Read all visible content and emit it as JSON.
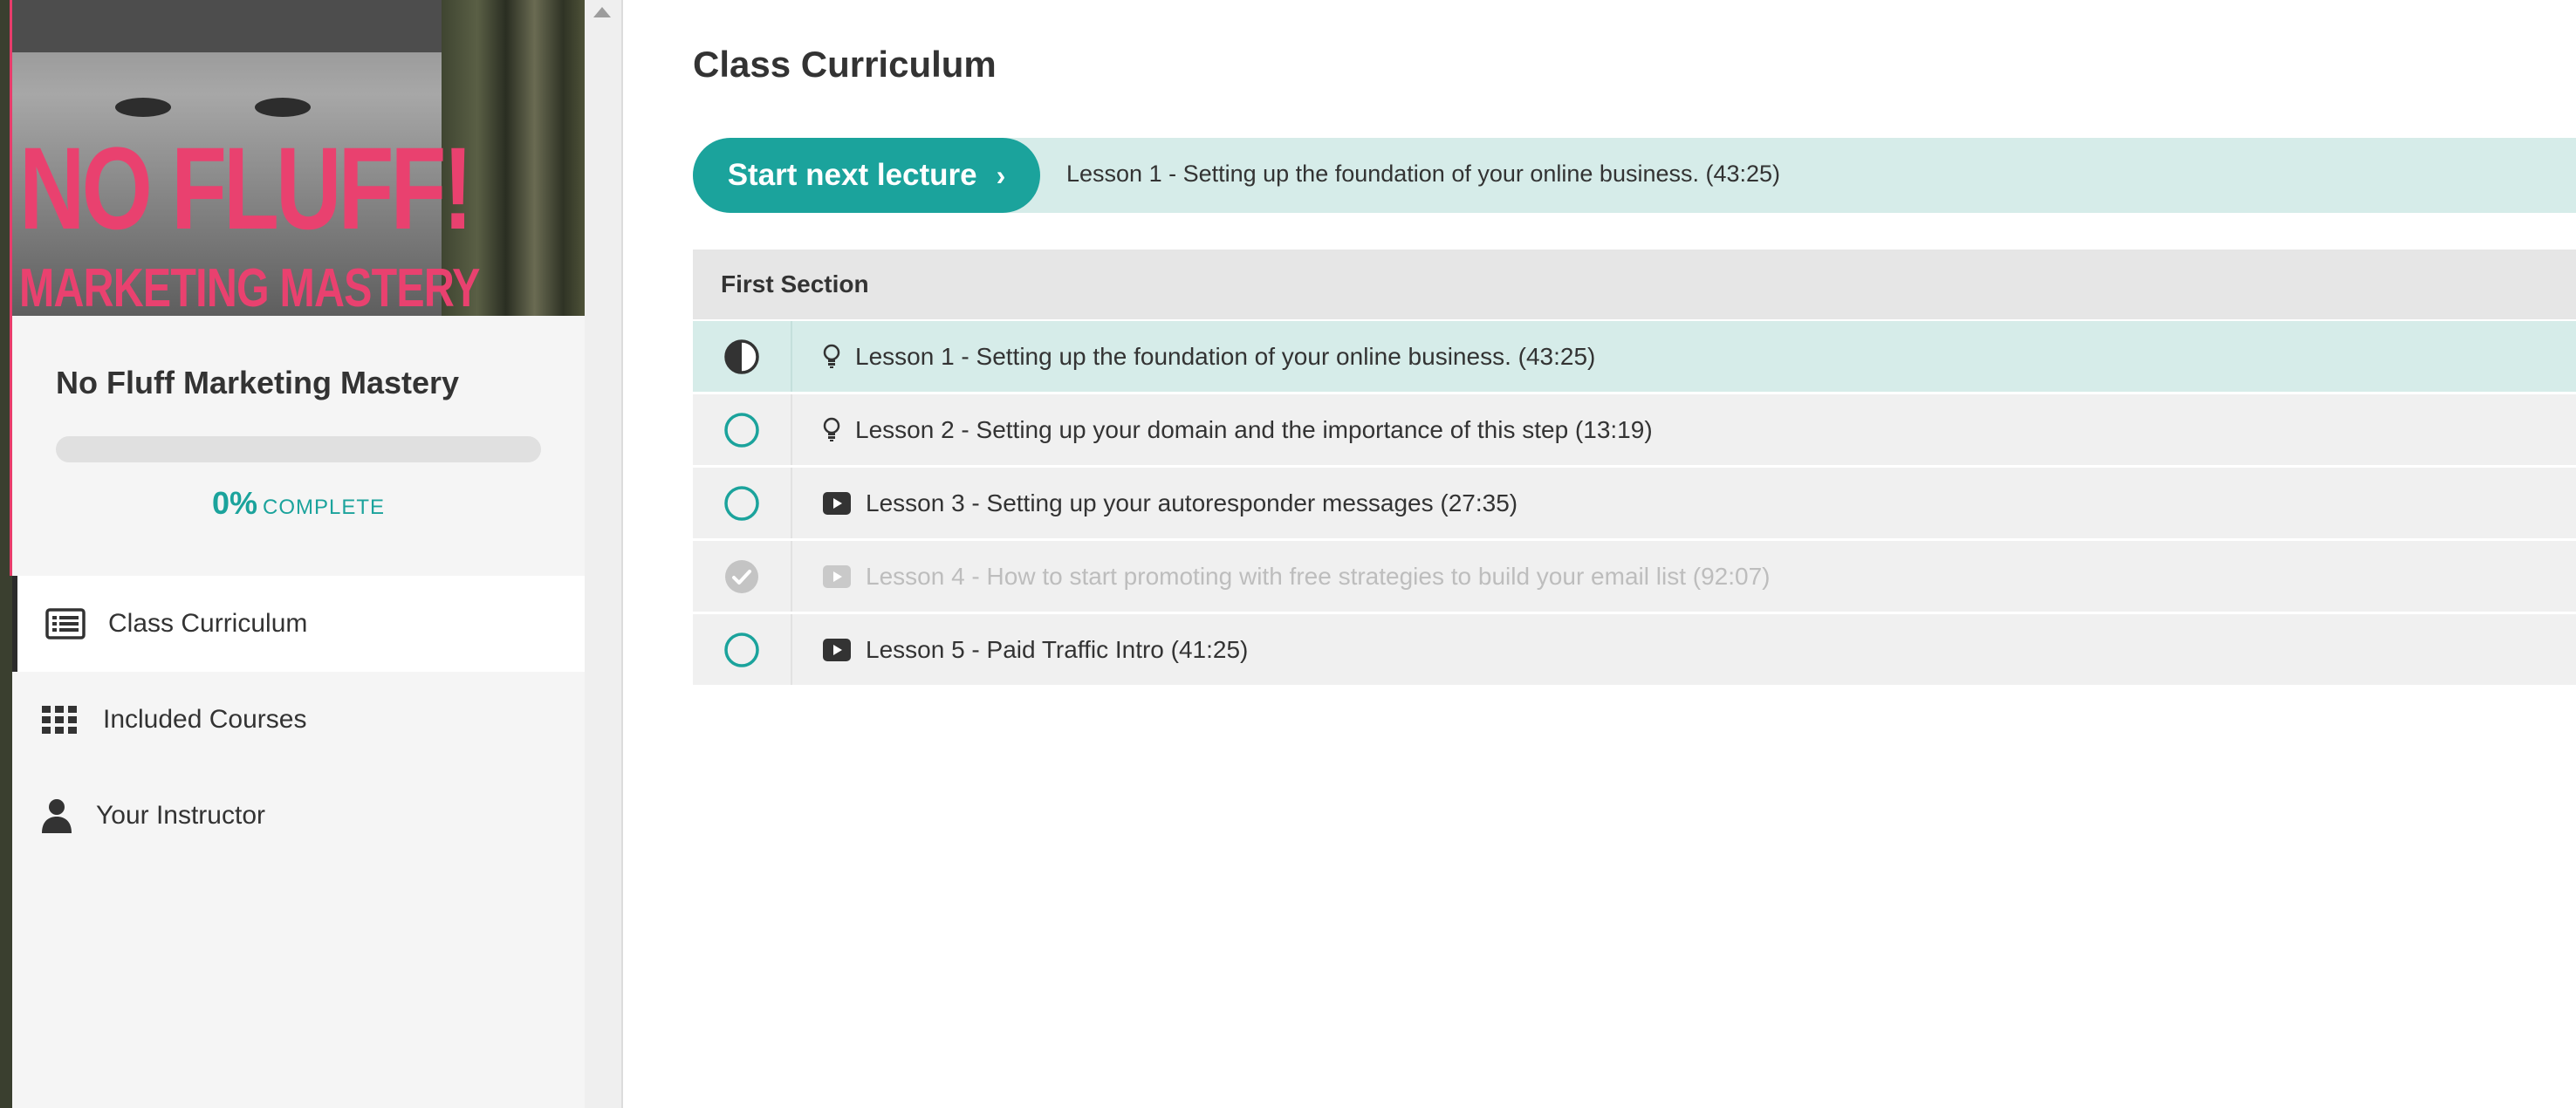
{
  "image_text": {
    "line1": "NO FLUFF!",
    "line2": "MARKETING MASTERY"
  },
  "sidebar": {
    "course_title": "No Fluff Marketing Mastery",
    "progress": {
      "percent_label": "0%",
      "complete_label": "COMPLETE",
      "fraction": 0
    },
    "nav": [
      {
        "label": "Class Curriculum",
        "icon": "curriculum-list-icon",
        "active": true
      },
      {
        "label": "Included Courses",
        "icon": "grid-icon",
        "active": false
      },
      {
        "label": "Your Instructor",
        "icon": "user-icon",
        "active": false
      }
    ]
  },
  "main": {
    "title": "Class Curriculum",
    "next": {
      "button_label": "Start next lecture",
      "chevron": "›",
      "lesson": "Lesson 1 - Setting up the foundation of your online business. (43:25)"
    },
    "section": {
      "title": "First Section",
      "lessons": [
        {
          "title": "Lesson 1 - Setting up the foundation of your online business. (43:25)",
          "type": "lightbulb-icon",
          "status": "in-progress"
        },
        {
          "title": "Lesson 2 - Setting up your domain and the importance of this step (13:19)",
          "type": "lightbulb-icon",
          "status": "not-started"
        },
        {
          "title": "Lesson 3 - Setting up your autoresponder messages (27:35)",
          "type": "video-icon",
          "status": "not-started"
        },
        {
          "title": "Lesson 4 - How to start promoting with free strategies to build your email list (92:07)",
          "type": "video-icon",
          "status": "completed"
        },
        {
          "title": "Lesson 5 - Paid Traffic Intro (41:25)",
          "type": "video-icon",
          "status": "not-started"
        }
      ]
    }
  },
  "colors": {
    "accent": "#1ba39c",
    "accent_light": "#d6ece9",
    "brand_pink": "#e9416f"
  }
}
